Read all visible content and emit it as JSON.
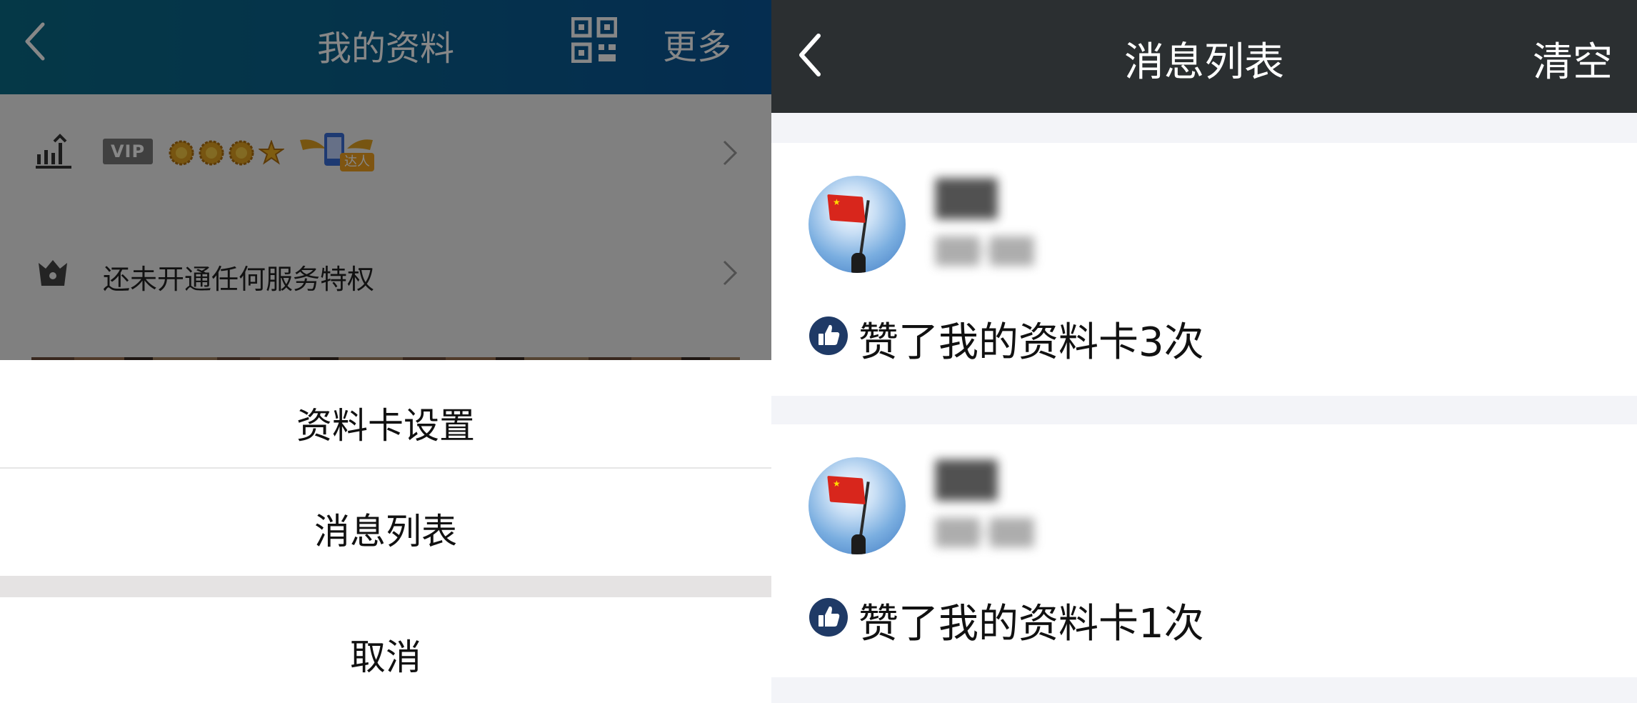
{
  "left_panel": {
    "header": {
      "title": "我的资料",
      "more": "更多",
      "background": "#0a5f8f"
    },
    "profile": {
      "vip_label": "VIP",
      "badge_label": "达人",
      "service_text": "还未开通任何服务特权"
    },
    "action_sheet": {
      "items": [
        "资料卡设置",
        "消息列表"
      ],
      "cancel": "取消"
    }
  },
  "right_panel": {
    "header": {
      "title": "消息列表",
      "clear": "清空",
      "background": "#2b2f31"
    },
    "messages": [
      {
        "name": "▇▇",
        "time": "▇▇-▇▇",
        "text": "赞了我的资料卡3次"
      },
      {
        "name": "▇▇",
        "time": "▇▇-▇▇",
        "text": "赞了我的资料卡1次"
      }
    ]
  },
  "icons": {
    "back": "chevron-left-icon",
    "qr": "qr-code-icon",
    "level": "level-up-icon",
    "service": "shop-icon",
    "like": "thumbs-up-icon",
    "arrow": "chevron-right-icon"
  },
  "colors": {
    "like_icon": "#1f3a66",
    "medal": "#e0a020",
    "list_background": "#f3f4f8"
  }
}
